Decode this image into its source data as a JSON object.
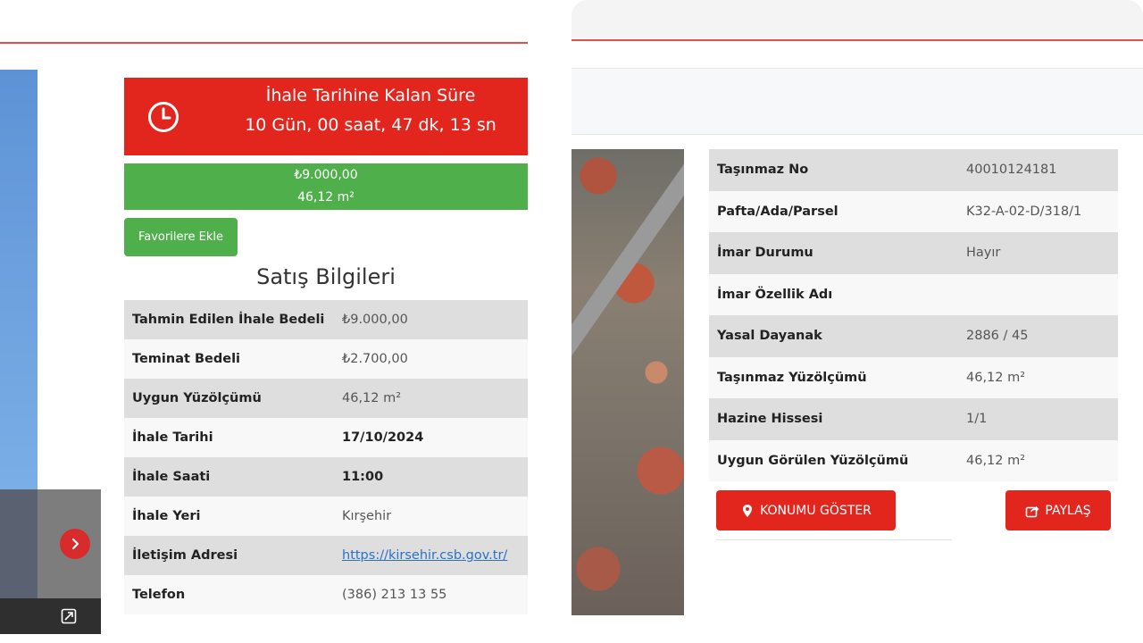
{
  "countdown": {
    "title": "İhale Tarihine Kalan Süre",
    "remaining": "10 Gün, 00 saat, 47 dk, 13 sn"
  },
  "price_bar": {
    "price": "₺9.000,00",
    "area": "46,12 m²"
  },
  "favorite_button": "Favorilere Ekle",
  "sales": {
    "title": "Satış Bilgileri",
    "rows": [
      {
        "label": "Tahmin Edilen İhale Bedeli",
        "value": "₺9.000,00"
      },
      {
        "label": "Teminat Bedeli",
        "value": "₺2.700,00"
      },
      {
        "label": "Uygun Yüzölçümü",
        "value": "46,12 m²"
      },
      {
        "label": "İhale Tarihi",
        "value": "17/10/2024"
      },
      {
        "label": "İhale Saati",
        "value": "11:00"
      },
      {
        "label": "İhale Yeri",
        "value": "Kırşehir"
      },
      {
        "label": "İletişim Adresi",
        "value": "https://kirsehir.csb.gov.tr/"
      },
      {
        "label": "Telefon",
        "value": "(386) 213 13 55"
      }
    ]
  },
  "property": {
    "rows": [
      {
        "label": "Taşınmaz No",
        "value": "40010124181"
      },
      {
        "label": "Pafta/Ada/Parsel",
        "value": "K32-A-02-D/318/1"
      },
      {
        "label": "İmar Durumu",
        "value": "Hayır"
      },
      {
        "label": "İmar Özellik Adı",
        "value": ""
      },
      {
        "label": "Yasal Dayanak",
        "value": "2886 / 45"
      },
      {
        "label": "Taşınmaz Yüzölçümü",
        "value": "46,12 m²"
      },
      {
        "label": "Hazine Hissesi",
        "value": "1/1"
      },
      {
        "label": "Uygun Görülen Yüzölçümü",
        "value": "46,12 m²"
      }
    ]
  },
  "buttons": {
    "show_location": "KONUMU GÖSTER",
    "share": "PAYLAŞ"
  },
  "colors": {
    "accent_red": "#e2261d",
    "accent_green": "#4fb04b",
    "row_gray": "#dedede",
    "link_blue": "#2a72c8"
  },
  "icons": [
    "clock-icon",
    "chevron-right-icon",
    "expand-icon",
    "map-marker-icon",
    "share-icon"
  ]
}
